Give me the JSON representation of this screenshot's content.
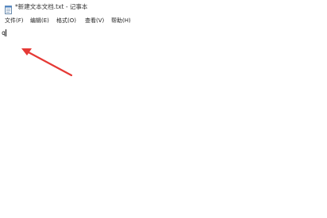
{
  "window": {
    "title": "*新建文本文档.txt - 记事本",
    "icon": "notepad-icon"
  },
  "menu": {
    "items": [
      {
        "label": "文件(F)"
      },
      {
        "label": "编辑(E)"
      },
      {
        "label": "格式(O)"
      },
      {
        "label": "查看(V)"
      },
      {
        "label": "帮助(H)"
      }
    ]
  },
  "editor": {
    "content": "q"
  },
  "annotation": {
    "type": "arrow",
    "color": "#e53935"
  }
}
